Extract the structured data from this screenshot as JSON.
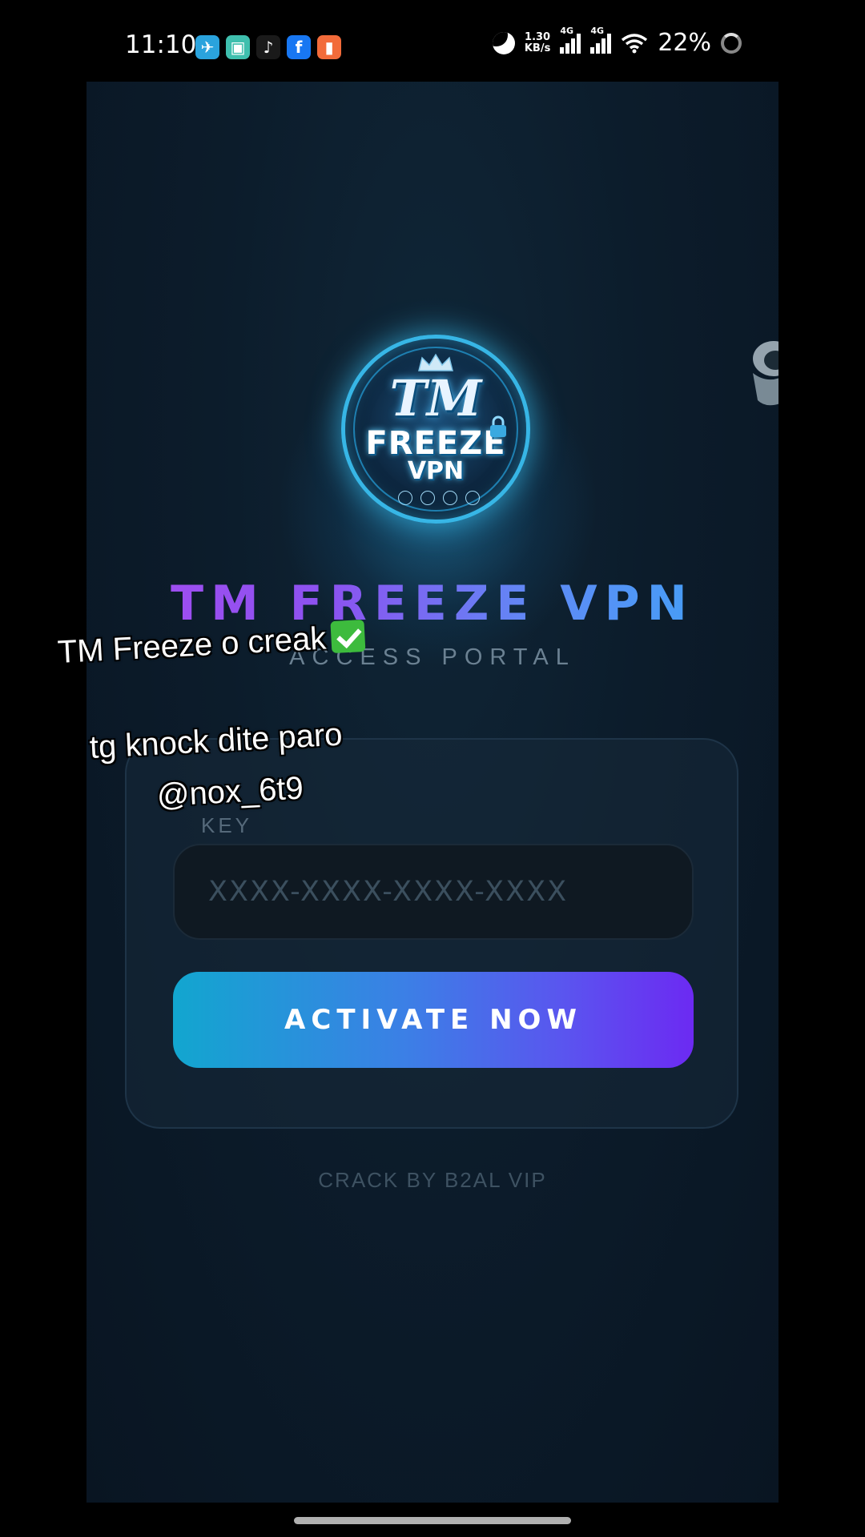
{
  "status_bar": {
    "time": "11:10",
    "apps": [
      {
        "name": "telegram-icon",
        "glyph": "✈",
        "color": "#2aa3dd"
      },
      {
        "name": "gallery-icon",
        "glyph": "▣",
        "color": "#3fbfae"
      },
      {
        "name": "tiktok-icon",
        "glyph": "♪",
        "color": "#1a1a1a"
      },
      {
        "name": "facebook-icon",
        "glyph": "f",
        "color": "#1877f2"
      },
      {
        "name": "store-icon",
        "glyph": "▮",
        "color": "#f26b3a"
      }
    ],
    "net_speed_value": "1.30",
    "net_speed_unit": "KB/s",
    "network_1": "4G",
    "network_2": "4G",
    "battery": "22%"
  },
  "app": {
    "logo": {
      "line1": "TM",
      "line2": "FREEZE",
      "line3": "VPN"
    },
    "title": "TM FREEZE VPN",
    "subtitle": "ACCESS PORTAL",
    "key_label": "KEY",
    "key_placeholder": "XXXX-XXXX-XXXX-XXXX",
    "key_value": "",
    "activate_label": "ACTIVATE NOW",
    "credit": "CRACK BY B2AL VIP"
  },
  "overlay": {
    "caption1": "TM Freeze o creak",
    "caption2": "tg knock dite paro",
    "caption3": "@nox_6t9"
  },
  "colors": {
    "title_gradient_start": "#a64cf0",
    "title_gradient_end": "#3aa7f7",
    "button_gradient_start": "#12a6cf",
    "button_gradient_end": "#6c2af2",
    "panel_bg": "#0c1c2b"
  }
}
